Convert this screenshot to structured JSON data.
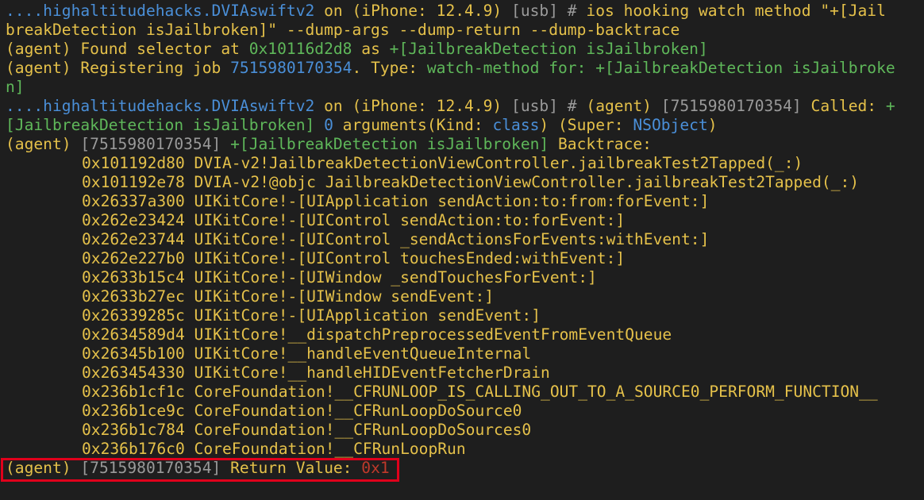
{
  "prompt": {
    "path": "....highaltitudehacks.DVIAswiftv2",
    "on": " on ",
    "device": "(iPhone: 12.4.9)",
    "conn": " [usb]",
    "hash": " # "
  },
  "command": {
    "line1": "ios hooking watch method \"+[Jail",
    "line2": "breakDetection isJailbroken]\" --dump-args --dump-return --dump-backtrace"
  },
  "found": {
    "prefix": "(agent) Found selector at ",
    "address": "0x10116d2d8",
    "as": " as ",
    "selector": "+[JailbreakDetection isJailbroken]"
  },
  "register": {
    "prefix": "(agent) Registering job ",
    "job": "7515980170354",
    "mid": ". Type: ",
    "type": "watch-method for: +[JailbreakDetection isJailbroke",
    "cont": "n]"
  },
  "called": {
    "agent": "(agent) ",
    "job": "[7515980170354]",
    "label": " Called: ",
    "plus": "+",
    "selector": "[JailbreakDetection isJailbroken]",
    "count": "0",
    "args": " arguments(Kind: ",
    "kind": "class",
    "super_open": ") (Super: ",
    "super": "NSObject",
    "close": ")"
  },
  "backtrace_header": {
    "agent": "(agent) ",
    "job": "[7515980170354]",
    "selector": " +[JailbreakDetection isJailbroken]",
    "label": " Backtrace:"
  },
  "backtrace": [
    "0x101192d80 DVIA-v2!JailbreakDetectionViewController.jailbreakTest2Tapped(_:)",
    "0x101192e78 DVIA-v2!@objc JailbreakDetectionViewController.jailbreakTest2Tapped(_:)",
    "0x26337a300 UIKitCore!-[UIApplication sendAction:to:from:forEvent:]",
    "0x262e23424 UIKitCore!-[UIControl sendAction:to:forEvent:]",
    "0x262e23744 UIKitCore!-[UIControl _sendActionsForEvents:withEvent:]",
    "0x262e227b0 UIKitCore!-[UIControl touchesEnded:withEvent:]",
    "0x2633b15c4 UIKitCore!-[UIWindow _sendTouchesForEvent:]",
    "0x2633b27ec UIKitCore!-[UIWindow sendEvent:]",
    "0x26339285c UIKitCore!-[UIApplication sendEvent:]",
    "0x2634589d4 UIKitCore!__dispatchPreprocessedEventFromEventQueue",
    "0x26345b100 UIKitCore!__handleEventQueueInternal",
    "0x263454330 UIKitCore!__handleHIDEventFetcherDrain",
    "0x236b1cf1c CoreFoundation!__CFRUNLOOP_IS_CALLING_OUT_TO_A_SOURCE0_PERFORM_FUNCTION__",
    "0x236b1ce9c CoreFoundation!__CFRunLoopDoSource0",
    "0x236b1c784 CoreFoundation!__CFRunLoopDoSources0",
    "0x236b176c0 CoreFoundation!__CFRunLoopRun"
  ],
  "return": {
    "agent": "(agent) ",
    "job": "[7515980170354]",
    "label": " Return Value: ",
    "value": "0x1"
  }
}
